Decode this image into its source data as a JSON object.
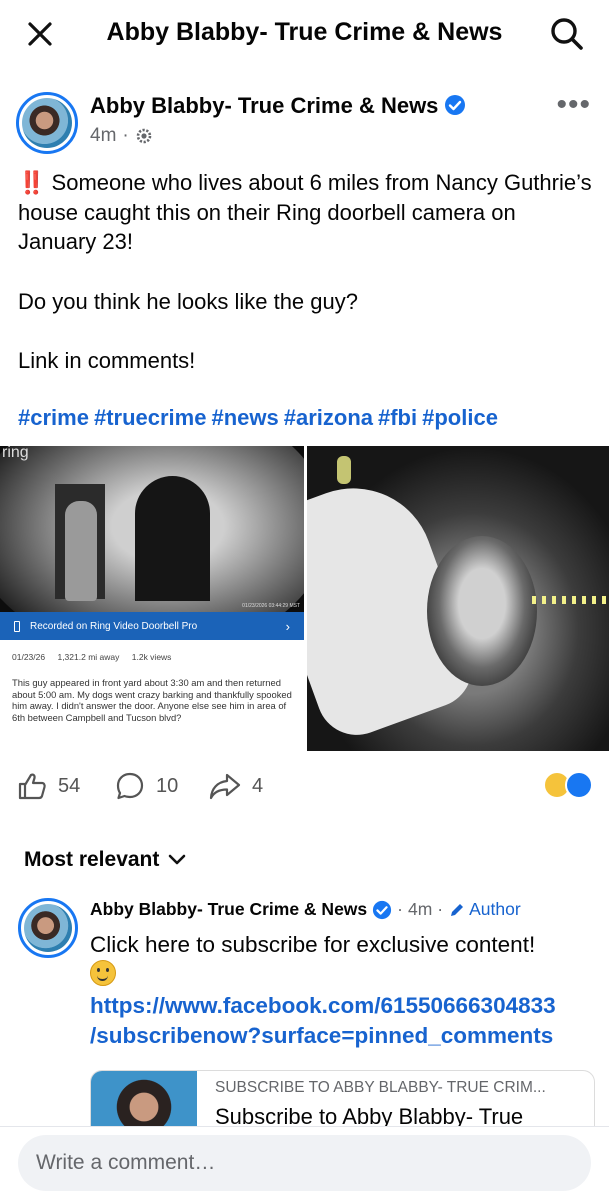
{
  "header": {
    "title": "Abby Blabby- True Crime & News",
    "close_icon": "close-icon",
    "search_icon": "search-icon"
  },
  "post": {
    "author": "Abby Blabby- True Crime & News",
    "verified": true,
    "time": "4m",
    "privacy_icon": "gear-icon",
    "text_line1_emoji": "‼️",
    "text_line1": "Someone who lives about 6 miles from Nancy Guthrie’s house caught this on their Ring doorbell camera on January 23!",
    "text_line2": "Do you think he looks like the guy?",
    "text_line3": "Link in comments!",
    "hashtags": [
      "#crime",
      "#truecrime",
      "#news",
      "#arizona",
      "#fbi",
      "#police"
    ]
  },
  "ring_image": {
    "logo": "ring",
    "timestamp": "01/23/2026 03:44:29 MST",
    "banner": "Recorded on Ring Video Doorbell Pro",
    "date": "01/23/26",
    "distance": "1,321.2 mi away",
    "views": "1.2k views",
    "description": "This guy appeared in front yard about 3:30 am and then returned about 5:00 am. My dogs went crazy barking and thankfully spooked him away. I didn't answer the door. Anyone else see him in area of 6th between Campbell and Tucson blvd?"
  },
  "actions": {
    "likes": "54",
    "comments": "10",
    "shares": "4",
    "reactions": [
      "wow",
      "like"
    ]
  },
  "comments": {
    "sort_label": "Most relevant",
    "items": [
      {
        "author": "Abby Blabby- True Crime & News",
        "time": "4m",
        "badge": "Author",
        "text": "Click here to subscribe for exclusive content!",
        "link_line1": "https://www.facebook.com/61550666304833",
        "link_line2": "/subscribenow?surface=pinned_comments",
        "preview_source": "SUBSCRIBE TO ABBY BLABBY- TRUE CRIM...",
        "preview_title": "Subscribe to Abby Blabby- True"
      }
    ]
  },
  "composer": {
    "placeholder": "Write a comment…"
  },
  "colors": {
    "accent": "#1877f2",
    "link": "#1763cf",
    "muted": "#65676b"
  }
}
